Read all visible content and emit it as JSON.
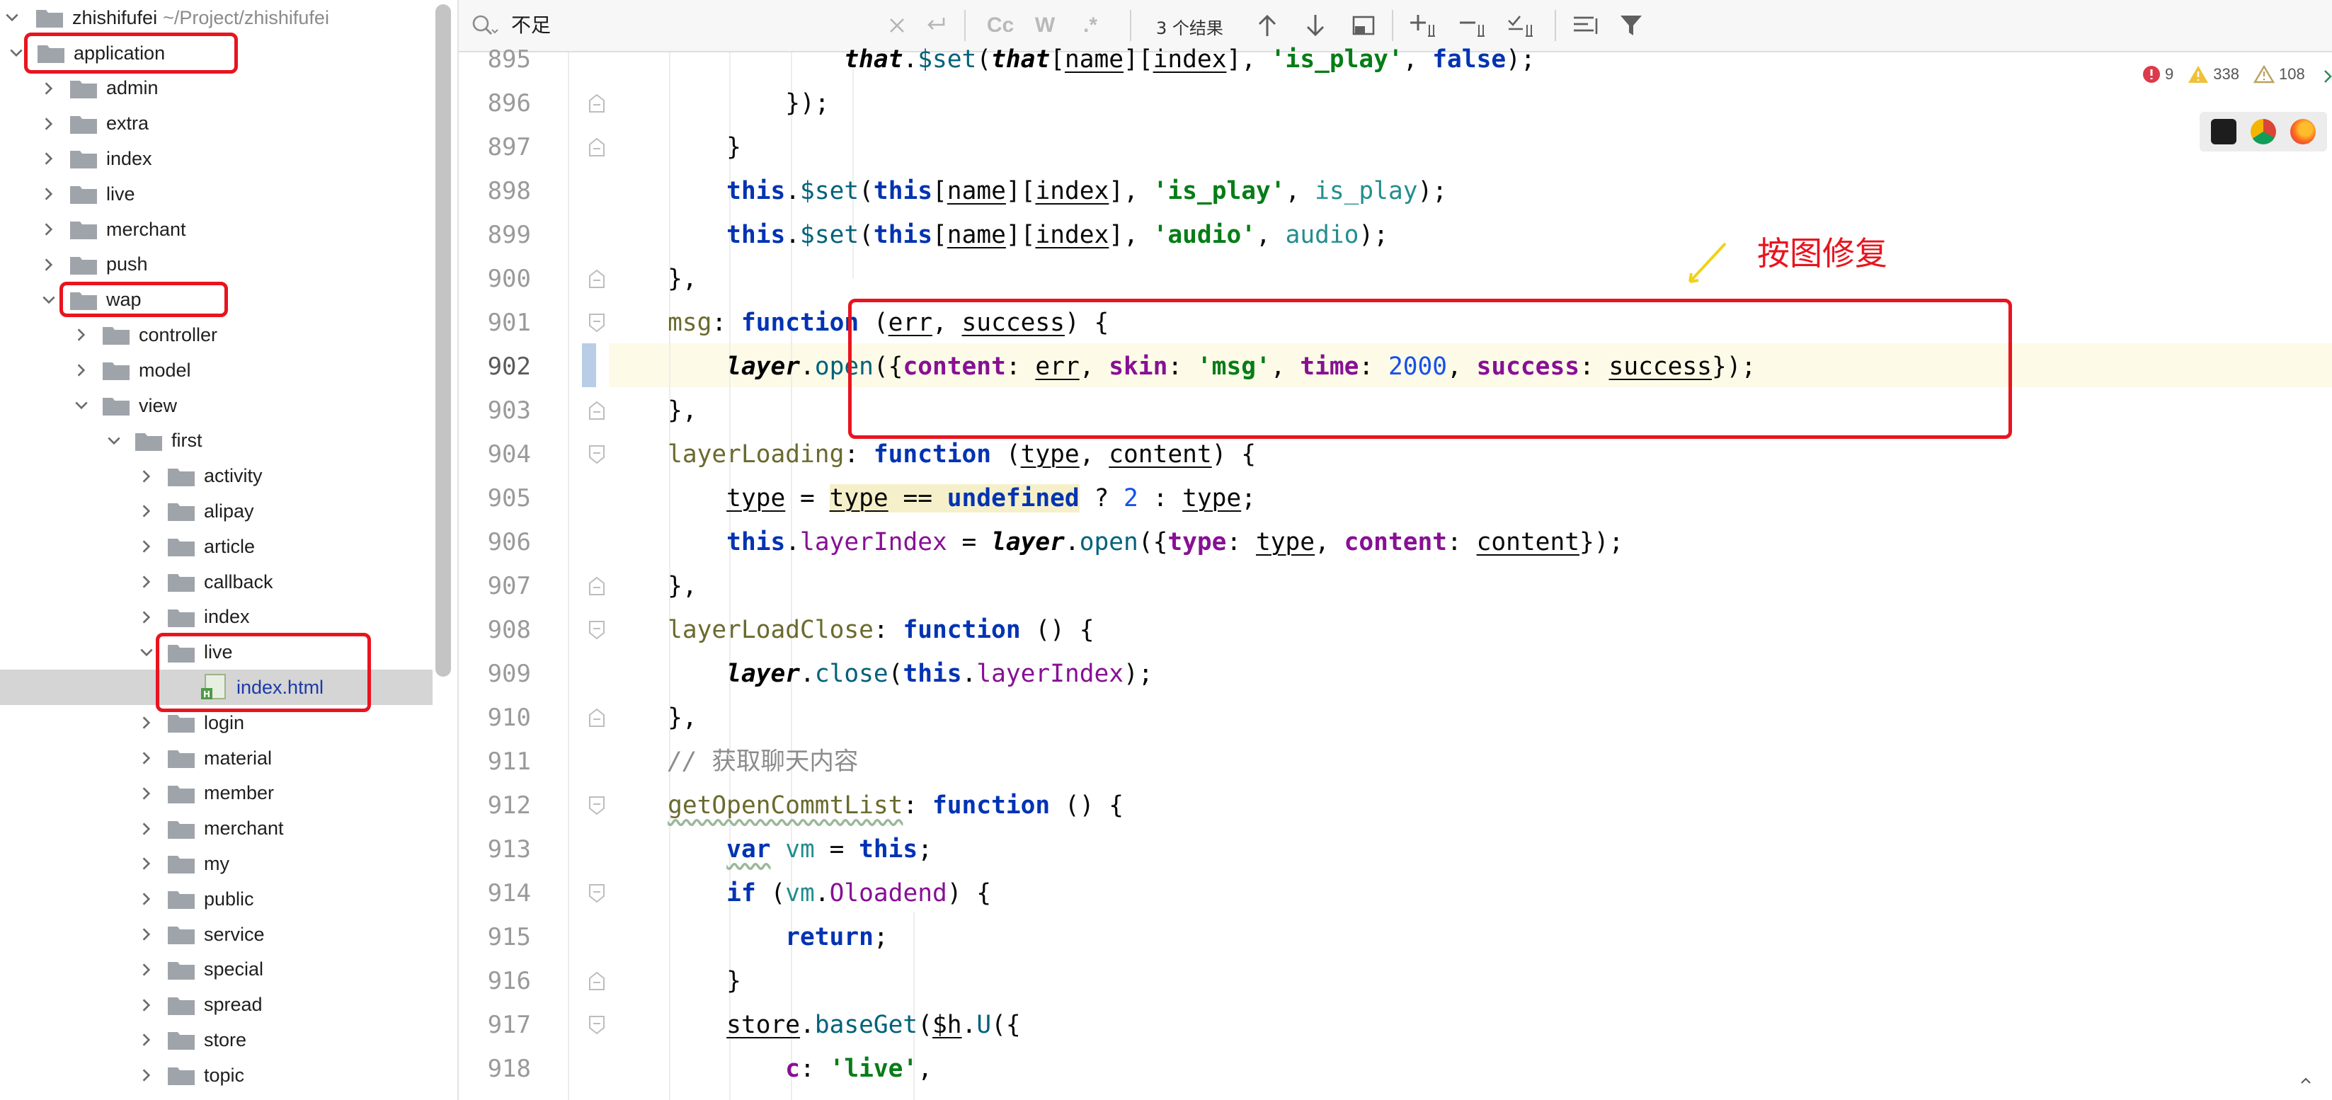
{
  "project": {
    "root_name": "zhishifufei",
    "root_path": "~/Project/zhishifufei",
    "items": [
      {
        "label": "application",
        "depth": 1,
        "expanded": true,
        "type": "folder"
      },
      {
        "label": "admin",
        "depth": 2,
        "expanded": false,
        "type": "folder"
      },
      {
        "label": "extra",
        "depth": 2,
        "expanded": false,
        "type": "folder"
      },
      {
        "label": "index",
        "depth": 2,
        "expanded": false,
        "type": "folder"
      },
      {
        "label": "live",
        "depth": 2,
        "expanded": false,
        "type": "folder"
      },
      {
        "label": "merchant",
        "depth": 2,
        "expanded": false,
        "type": "folder"
      },
      {
        "label": "push",
        "depth": 2,
        "expanded": false,
        "type": "folder"
      },
      {
        "label": "wap",
        "depth": 2,
        "expanded": true,
        "type": "folder"
      },
      {
        "label": "controller",
        "depth": 3,
        "expanded": false,
        "type": "folder"
      },
      {
        "label": "model",
        "depth": 3,
        "expanded": false,
        "type": "folder"
      },
      {
        "label": "view",
        "depth": 3,
        "expanded": true,
        "type": "folder"
      },
      {
        "label": "first",
        "depth": 4,
        "expanded": true,
        "type": "folder"
      },
      {
        "label": "activity",
        "depth": 5,
        "expanded": false,
        "type": "folder"
      },
      {
        "label": "alipay",
        "depth": 5,
        "expanded": false,
        "type": "folder"
      },
      {
        "label": "article",
        "depth": 5,
        "expanded": false,
        "type": "folder"
      },
      {
        "label": "callback",
        "depth": 5,
        "expanded": false,
        "type": "folder"
      },
      {
        "label": "index",
        "depth": 5,
        "expanded": false,
        "type": "folder"
      },
      {
        "label": "live",
        "depth": 5,
        "expanded": true,
        "type": "folder"
      },
      {
        "label": "index.html",
        "depth": 6,
        "expanded": false,
        "type": "html-file",
        "selected": true
      },
      {
        "label": "login",
        "depth": 5,
        "expanded": false,
        "type": "folder"
      },
      {
        "label": "material",
        "depth": 5,
        "expanded": false,
        "type": "folder"
      },
      {
        "label": "member",
        "depth": 5,
        "expanded": false,
        "type": "folder"
      },
      {
        "label": "merchant",
        "depth": 5,
        "expanded": false,
        "type": "folder"
      },
      {
        "label": "my",
        "depth": 5,
        "expanded": false,
        "type": "folder"
      },
      {
        "label": "public",
        "depth": 5,
        "expanded": false,
        "type": "folder"
      },
      {
        "label": "service",
        "depth": 5,
        "expanded": false,
        "type": "folder"
      },
      {
        "label": "special",
        "depth": 5,
        "expanded": false,
        "type": "folder"
      },
      {
        "label": "spread",
        "depth": 5,
        "expanded": false,
        "type": "folder"
      },
      {
        "label": "store",
        "depth": 5,
        "expanded": false,
        "type": "folder"
      },
      {
        "label": "topic",
        "depth": 5,
        "expanded": false,
        "type": "folder"
      }
    ]
  },
  "search": {
    "query": "不足",
    "results_count": "3 个结果",
    "match_case_label": "Cc",
    "words_label": "W",
    "regex_label": ".*"
  },
  "editor": {
    "current_line": "902",
    "line_numbers": [
      "895",
      "896",
      "897",
      "898",
      "899",
      "900",
      "901",
      "902",
      "903",
      "904",
      "905",
      "906",
      "907",
      "908",
      "909",
      "910",
      "911",
      "912",
      "913",
      "914",
      "915",
      "916",
      "917",
      "918"
    ],
    "comment_text": "// 获取聊天内容"
  },
  "inspections": {
    "errors": "9",
    "warnings": "338",
    "weak_warnings": "108"
  },
  "annotation": {
    "text": "按图修复"
  },
  "colors": {
    "annotation_red": "#e8141f",
    "keyword": "#0033b3",
    "string": "#067d17",
    "property": "#871094",
    "current_line": "#fdfbe8",
    "selection_row": "#d5d5d5"
  }
}
